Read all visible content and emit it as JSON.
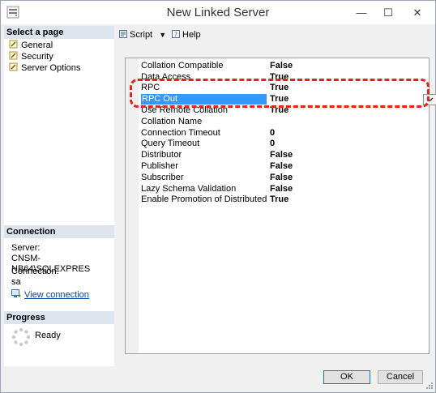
{
  "window": {
    "title": "New Linked Server"
  },
  "title_controls": {
    "minimize": "—",
    "maximize": "☐",
    "close": "✕"
  },
  "left_panel": {
    "select_page_header": "Select a page",
    "pages": [
      {
        "label": "General",
        "icon": "wrench-page-icon"
      },
      {
        "label": "Security",
        "icon": "wrench-page-icon"
      },
      {
        "label": "Server Options",
        "icon": "wrench-page-icon",
        "selected": true
      }
    ],
    "connection_header": "Connection",
    "server_label": "Server:",
    "server_value": "CNSM-NB64\\SQLEXPRES",
    "connection_label": "Connection:",
    "connection_value": "sa",
    "view_connection_link": "View connection",
    "progress_header": "Progress",
    "progress_status": "Ready"
  },
  "toolbar": {
    "script_label": "Script",
    "help_label": "Help"
  },
  "properties": [
    {
      "name": "Collation Compatible",
      "value": "False"
    },
    {
      "name": "Data Access",
      "value": "True"
    },
    {
      "name": "RPC",
      "value": "True"
    },
    {
      "name": "RPC Out",
      "value": "True",
      "selected": true
    },
    {
      "name": "Use Remote Collation",
      "value": "True"
    },
    {
      "name": "Collation Name",
      "value": ""
    },
    {
      "name": "Connection Timeout",
      "value": "0"
    },
    {
      "name": "Query Timeout",
      "value": "0"
    },
    {
      "name": "Distributor",
      "value": "False"
    },
    {
      "name": "Publisher",
      "value": "False"
    },
    {
      "name": "Subscriber",
      "value": "False"
    },
    {
      "name": "Lazy Schema Validation",
      "value": "False"
    },
    {
      "name": "Enable Promotion of Distributed",
      "value": "True"
    }
  ],
  "buttons": {
    "ok": "OK",
    "cancel": "Cancel"
  },
  "colors": {
    "selection": "#3399ff",
    "highlight": "#e2231a",
    "section_header": "#dee4ee",
    "link": "#0645ad"
  }
}
